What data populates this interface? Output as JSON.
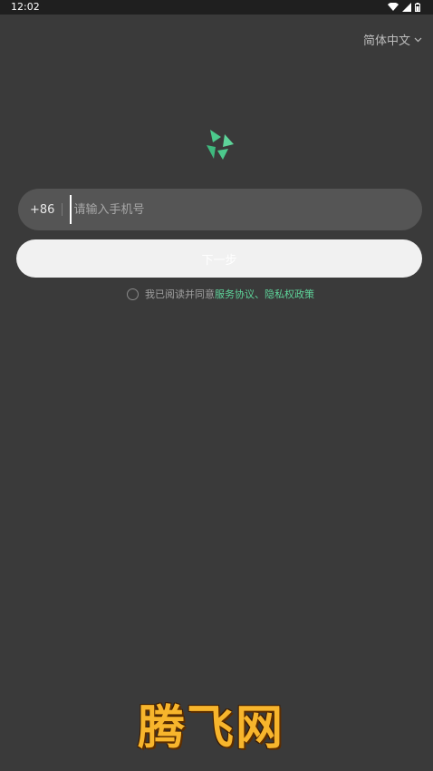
{
  "status_bar": {
    "time": "12:02",
    "icons": [
      "wifi-icon",
      "signal-icon",
      "battery-icon"
    ]
  },
  "language": {
    "selected": "简体中文"
  },
  "login": {
    "country_code": "+86",
    "phone_placeholder": "请输入手机号",
    "phone_value": "",
    "next_label": "下一步",
    "agreement_prefix": "我已阅读并同意",
    "terms_link": "服务协议",
    "separator": "、",
    "privacy_link": "隐私权政策"
  },
  "watermark": {
    "text": "腾飞网"
  },
  "colors": {
    "background": "#3a3a3a",
    "accent": "#5ed49a",
    "button": "#f1f1f1",
    "field": "#555555"
  }
}
